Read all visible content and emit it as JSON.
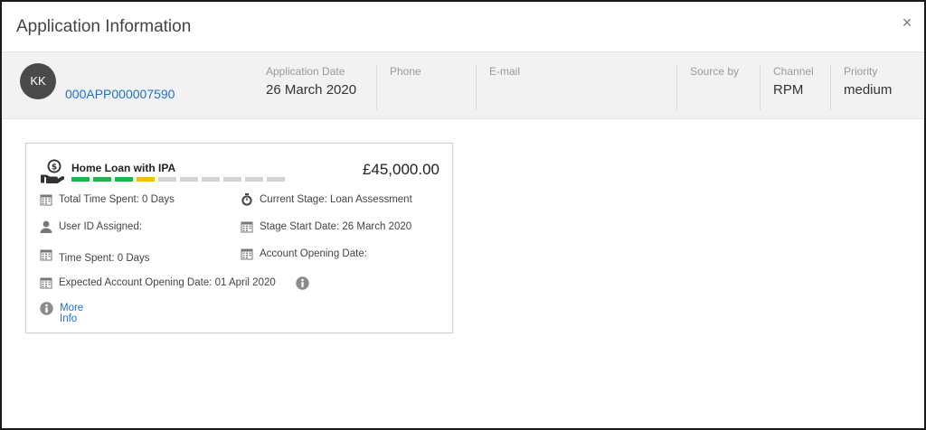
{
  "window": {
    "title": "Application Information",
    "close_symbol": "×"
  },
  "header": {
    "avatar_initials": "KK",
    "application_id": "000APP000007590",
    "fields": [
      {
        "label": "Application Date",
        "value": "26 March 2020"
      },
      {
        "label": "Phone",
        "value": ""
      },
      {
        "label": "E-mail",
        "value": ""
      },
      {
        "label": "Source by",
        "value": ""
      },
      {
        "label": "Channel",
        "value": "RPM"
      },
      {
        "label": "Priority",
        "value": "medium"
      }
    ]
  },
  "card": {
    "product": "Home Loan with IPA",
    "amount": "£45,000.00",
    "progress": {
      "total_stages": 10,
      "stages": [
        "complete",
        "complete",
        "complete",
        "current",
        "pending",
        "pending",
        "pending",
        "pending",
        "pending",
        "pending"
      ],
      "colors": {
        "complete": "#1db34d",
        "current": "#f2c200",
        "pending": "#d2d2d2"
      }
    },
    "details": {
      "total_time_spent": "Total Time Spent: 0 Days",
      "current_stage": "Current Stage: Loan Assessment",
      "user_id_assigned": "User ID Assigned:",
      "stage_start_date": "Stage Start Date: 26 March 2020",
      "time_spent": "Time Spent: 0 Days",
      "account_opening_date": "Account Opening Date:",
      "expected_account_opening_date": "Expected Account Opening Date: 01 April 2020"
    },
    "more_info": "More Info"
  },
  "icons": {
    "calendar": "calendar-icon",
    "user": "user-icon",
    "stopwatch": "stopwatch-icon",
    "info": "info-icon",
    "loan": "hand-money-icon"
  },
  "colors": {
    "link": "#1f6fd1",
    "header_bg": "#f2f2f2",
    "avatar_bg": "#4a4a4a"
  }
}
